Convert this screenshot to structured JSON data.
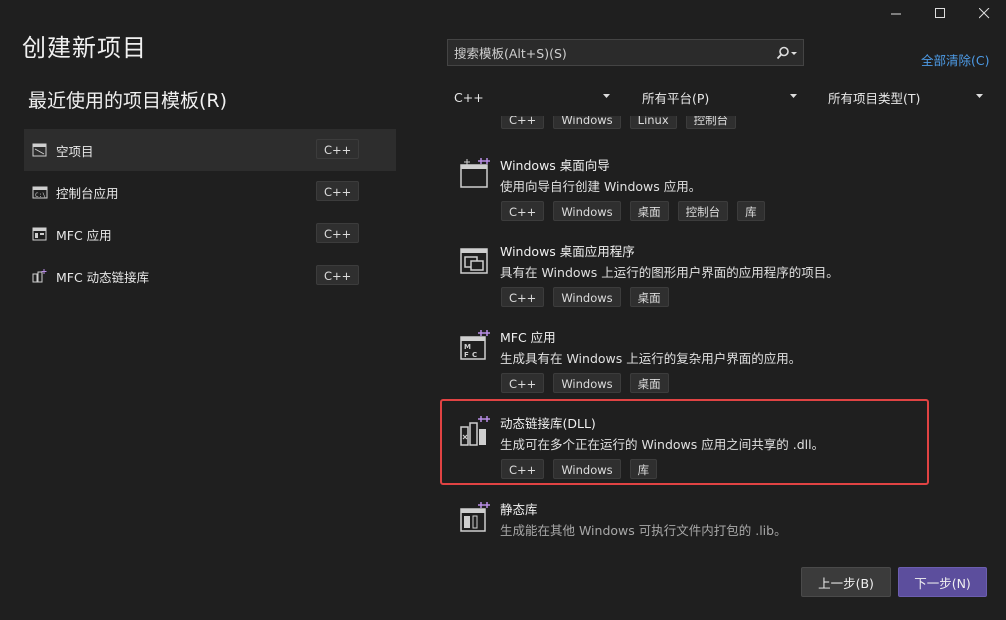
{
  "window": {
    "title": "创建新项目",
    "controls": [
      "minimize-icon",
      "maximize-icon",
      "close-icon"
    ]
  },
  "recent": {
    "heading": "最近使用的项目模板(R)",
    "items": [
      {
        "label": "空项目",
        "tag": "C++",
        "icon": "empty-project-icon",
        "selected": true
      },
      {
        "label": "控制台应用",
        "tag": "C++",
        "icon": "console-app-icon"
      },
      {
        "label": "MFC 应用",
        "tag": "C++",
        "icon": "mfc-app-icon"
      },
      {
        "label": "MFC 动态链接库",
        "tag": "C++",
        "icon": "mfc-dll-icon"
      }
    ]
  },
  "search": {
    "placeholder": "搜索模板(Alt+S)(S)",
    "icon": "search-icon"
  },
  "clear_all": "全部清除(C)",
  "filters": {
    "language": "C++",
    "platform": "所有平台(P)",
    "project_type": "所有项目类型(T)"
  },
  "templates": [
    {
      "name": "Windows 桌面向导",
      "description": "使用向导自行创建 Windows 应用。",
      "tags": [
        "C++",
        "Windows",
        "桌面",
        "控制台",
        "库"
      ],
      "icon": "desktop-wizard-icon"
    },
    {
      "name": "Windows 桌面应用程序",
      "description": "具有在 Windows 上运行的图形用户界面的应用程序的项目。",
      "tags": [
        "C++",
        "Windows",
        "桌面"
      ],
      "icon": "desktop-app-icon"
    },
    {
      "name": "MFC 应用",
      "description": "生成具有在 Windows 上运行的复杂用户界面的应用。",
      "tags": [
        "C++",
        "Windows",
        "桌面"
      ],
      "icon": "mfc-template-icon"
    },
    {
      "name": "动态链接库(DLL)",
      "description": "生成可在多个正在运行的 Windows 应用之间共享的 .dll。",
      "tags": [
        "C++",
        "Windows",
        "库"
      ],
      "icon": "dll-icon",
      "highlighted": true
    },
    {
      "name": "静态库",
      "description": "生成能在其他 Windows 可执行文件内打包的 .lib。",
      "tags": [],
      "icon": "static-lib-icon"
    }
  ],
  "partial_top_tags": [
    "C++",
    "Windows",
    "Linux",
    "控制台"
  ],
  "buttons": {
    "back": "上一步(B)",
    "next": "下一步(N)"
  },
  "colors": {
    "accent": "#5c4e9d",
    "link": "#4d9be6",
    "highlight": "#e04343"
  }
}
